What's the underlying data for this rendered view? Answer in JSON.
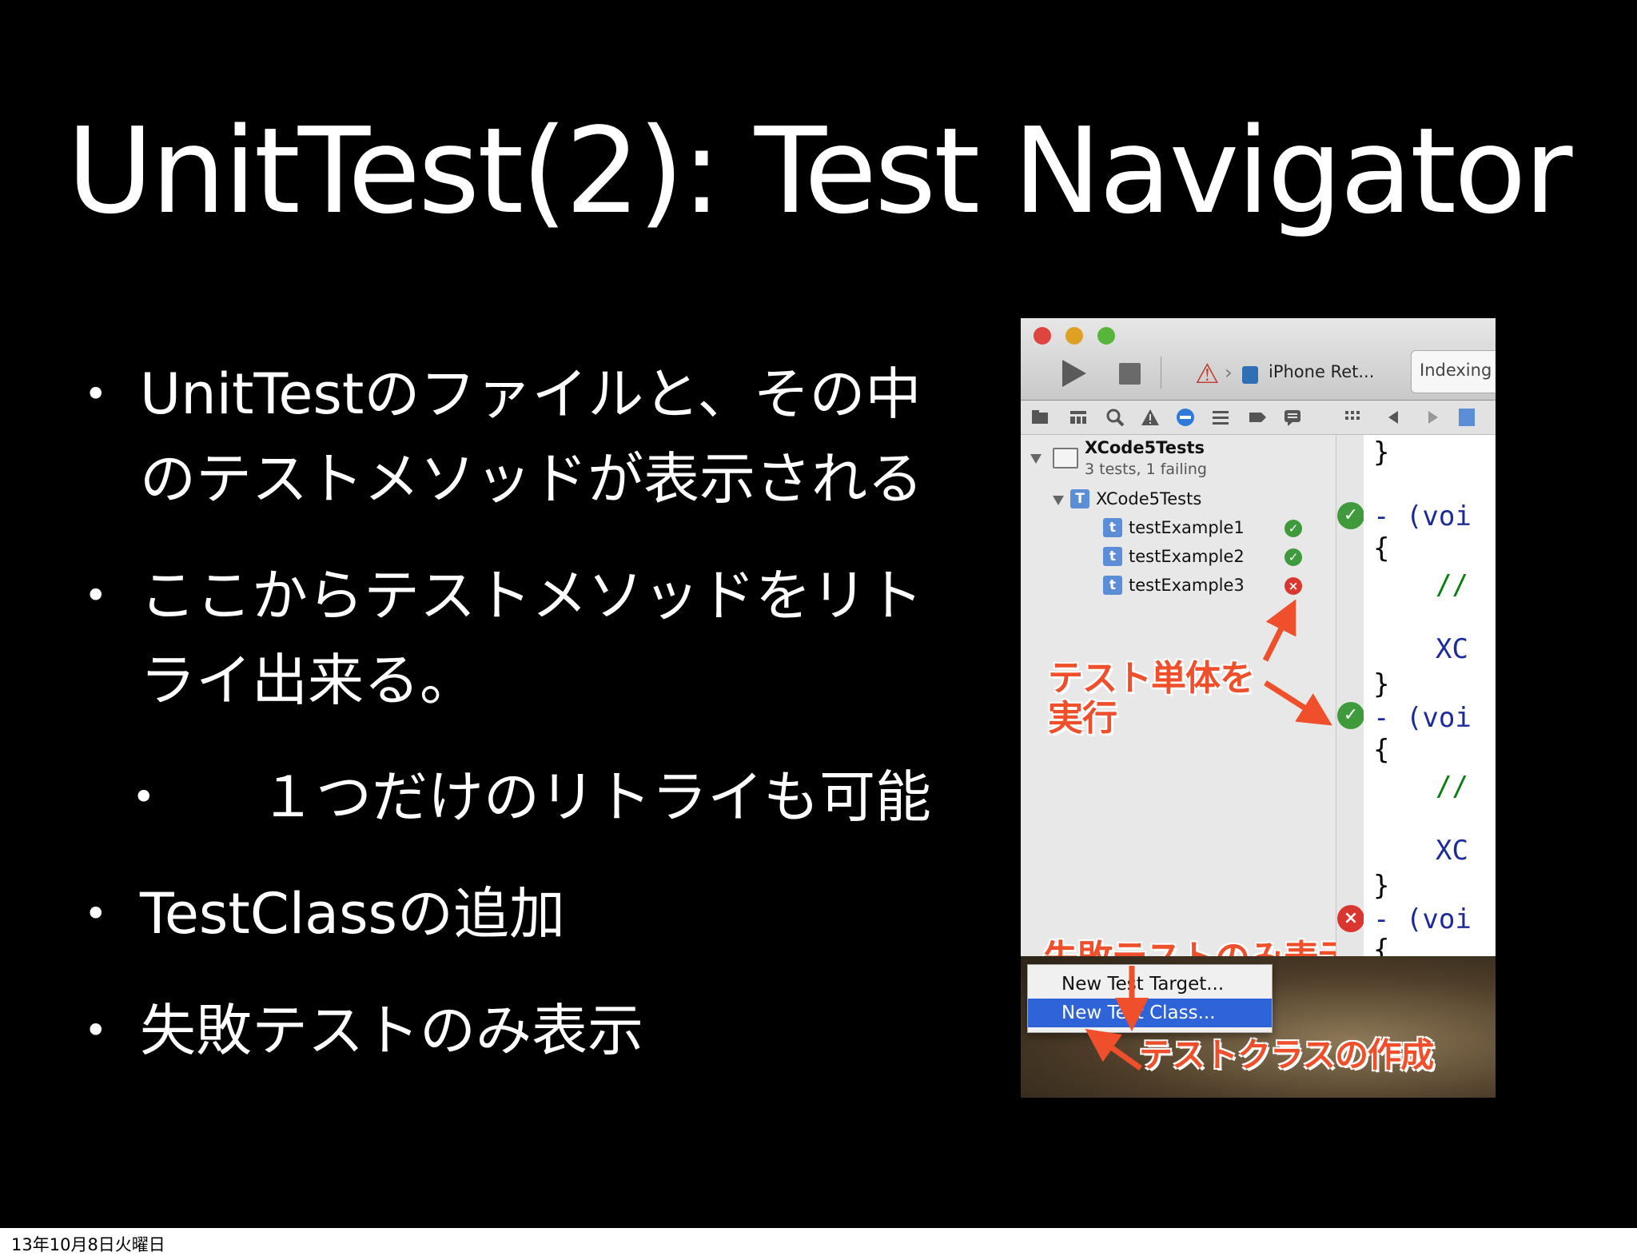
{
  "slide": {
    "title": "UnitTest(2): Test Navigator",
    "bullets": [
      {
        "lines": [
          "UnitTestのファイルと、その中",
          "のテストメソッドが表示される"
        ]
      },
      {
        "lines": [
          "ここからテストメソッドをリト",
          "ライ出来る。"
        ]
      },
      {
        "lines": [
          "１つだけのリトライも可能"
        ],
        "sub": true
      },
      {
        "lines": [
          "TestClassの追加"
        ]
      },
      {
        "lines": [
          "失敗テストのみ表示"
        ]
      }
    ],
    "bullet_glyph": "•",
    "footer": "13年10月8日火曜日"
  },
  "screenshot": {
    "toolbar": {
      "device": "iPhone Ret...",
      "status": "Indexing",
      "chevron": "›"
    },
    "navigator": {
      "project": "XCode5Tests",
      "project_sub": "3 tests, 1 failing",
      "target": "XCode5Tests",
      "tests": [
        {
          "name": "testExample1",
          "status": "pass"
        },
        {
          "name": "testExample2",
          "status": "pass"
        },
        {
          "name": "testExample3",
          "status": "fail"
        }
      ],
      "test_badge": "t",
      "target_badge": "T",
      "add_glyph": "+"
    },
    "code_lines": {
      "l1": "}",
      "l2": "- (voi",
      "l3": "{",
      "l4": "//",
      "l5": "XC",
      "l6": "}",
      "l7": "- (voi",
      "l8": "{",
      "l9": "//",
      "l10": "XC",
      "l11": "}",
      "l12": "- (voi",
      "l13": "{"
    },
    "annotations": {
      "run_single": [
        "テスト単体を",
        "実行"
      ],
      "failed_only": "失敗テストのみ表示",
      "create_class": "テストクラスの作成"
    },
    "menu": {
      "items": [
        "New Test Target...",
        "New Test Class..."
      ],
      "selected": "New Test Class..."
    },
    "glyphs": {
      "pass": "✓",
      "fail": "×"
    }
  },
  "colors": {
    "slide_bg": "#000000",
    "slide_text": "#ffffff",
    "annotation": "#ef4f2a",
    "pass": "#3e9a3b",
    "fail": "#d9362f",
    "menu_selected": "#2f64d8"
  }
}
